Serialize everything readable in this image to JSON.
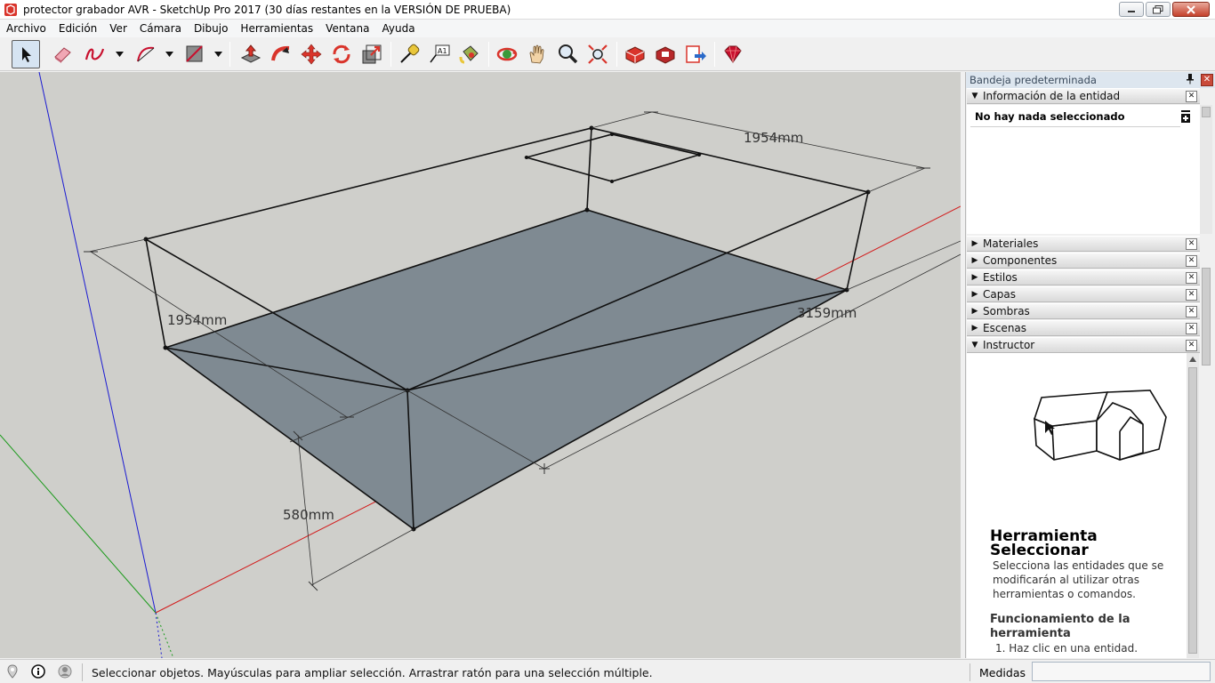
{
  "window": {
    "title": "protector grabador AVR - SketchUp Pro 2017 (30 días restantes en la VERSIÓN DE PRUEBA)"
  },
  "menu": [
    "Archivo",
    "Edición",
    "Ver",
    "Cámara",
    "Dibujo",
    "Herramientas",
    "Ventana",
    "Ayuda"
  ],
  "toolbar": {
    "tools": [
      "select-icon",
      "eraser-icon",
      "freehand-icon",
      "arc-icon",
      "rectangle-icon",
      "push-pull-icon",
      "follow-me-icon",
      "move-icon",
      "rotate-icon",
      "scale-icon",
      "tape-measure-icon",
      "text-icon",
      "paint-bucket-icon",
      "orbit-icon",
      "pan-icon",
      "zoom-icon",
      "zoom-extents-icon",
      "3d-warehouse-icon",
      "extension-warehouse-icon",
      "send-to-layout-icon",
      "extension-manager-icon"
    ]
  },
  "viewport": {
    "dimensions": {
      "top_width": "1954mm",
      "left_width": "1954mm",
      "length": "3159mm",
      "height": "580mm"
    }
  },
  "tray": {
    "title": "Bandeja predeterminada",
    "entity_info": {
      "label": "Información de la entidad",
      "status": "No hay nada seleccionado"
    },
    "panels": [
      "Materiales",
      "Componentes",
      "Estilos",
      "Capas",
      "Sombras",
      "Escenas",
      "Instructor"
    ],
    "instructor": {
      "title": "Herramienta Seleccionar",
      "description": "Selecciona las entidades que se modificarán al utilizar otras herramientas o comandos.",
      "subtitle": "Funcionamiento de la herramienta",
      "step": "1. Haz clic en una entidad."
    }
  },
  "status": {
    "message": "Seleccionar objetos. Mayúsculas para ampliar selección. Arrastrar ratón para una selección múltiple.",
    "measurements_label": "Medidas",
    "measurements_value": ""
  },
  "colors": {
    "viewport_bg": "#cfcfcb",
    "face": "#7f8a92",
    "axis_red": "#d21a1a",
    "axis_green": "#1a9a1a",
    "axis_blue": "#1a1ad2"
  }
}
